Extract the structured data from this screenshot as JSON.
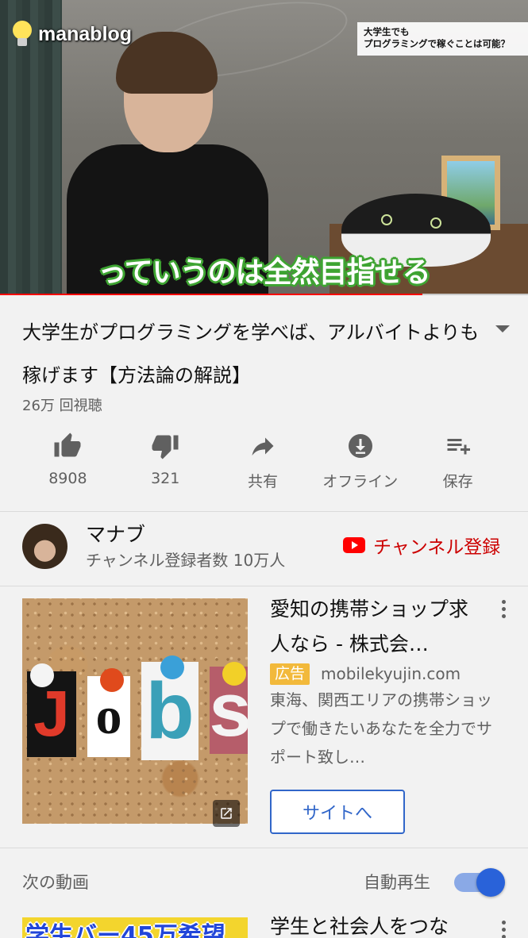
{
  "player": {
    "logo_text": "manablog",
    "corner_caption_line1": "大学生でも",
    "corner_caption_line2": "プログラミングで稼ぐことは可能？",
    "subtitle": "っていうのは全然目指せる",
    "progress_fraction": 0.8
  },
  "video": {
    "title": "大学生がプログラミングを学べば、アルバイトよりも稼げます【方法論の解説】",
    "views": "26万 回視聴"
  },
  "actions": [
    {
      "icon": "thumbs-up-icon",
      "label": "8908"
    },
    {
      "icon": "thumbs-down-icon",
      "label": "321"
    },
    {
      "icon": "share-icon",
      "label": "共有"
    },
    {
      "icon": "download-icon",
      "label": "オフライン"
    },
    {
      "icon": "playlist-add-icon",
      "label": "保存"
    }
  ],
  "channel": {
    "name": "マナブ",
    "subscribers": "チャンネル登録者数 10万人",
    "subscribe_label": "チャンネル登録"
  },
  "ad": {
    "title": "愛知の携帯ショップ求人なら - 株式会…",
    "badge": "広告",
    "domain": "mobilekyujin.com",
    "description": "東海、関西エリアの携帯ショップで働きたいあなたを全力でサポート致し…",
    "button": "サイトへ",
    "thumb_letters": [
      "J",
      "o",
      "b",
      "s"
    ]
  },
  "up_next": {
    "label": "次の動画",
    "autoplay_label": "自動再生",
    "autoplay_on": true,
    "first_title": "学生と社会人をつな",
    "first_thumb_text": "学生バー45万希望"
  },
  "colors": {
    "accent_red": "#ff0000",
    "link_blue": "#3166c9",
    "ad_badge": "#f2b93b",
    "toggle_blue": "#2962d9"
  }
}
